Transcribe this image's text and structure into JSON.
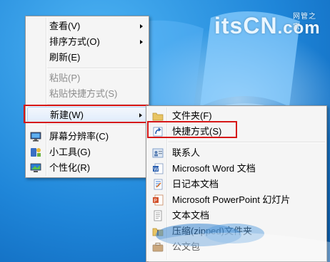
{
  "context_menu": {
    "items": [
      {
        "label": "查看(V)",
        "has_submenu": true,
        "enabled": true
      },
      {
        "label": "排序方式(O)",
        "has_submenu": true,
        "enabled": true
      },
      {
        "label": "刷新(E)",
        "has_submenu": false,
        "enabled": true
      },
      {
        "label": "粘贴(P)",
        "has_submenu": false,
        "enabled": false
      },
      {
        "label": "粘贴快捷方式(S)",
        "has_submenu": false,
        "enabled": false
      },
      {
        "label": "新建(W)",
        "has_submenu": true,
        "enabled": true,
        "highlighted": true
      },
      {
        "label": "屏幕分辨率(C)",
        "icon": "monitor-icon",
        "enabled": true
      },
      {
        "label": "小工具(G)",
        "icon": "gadgets-icon",
        "enabled": true
      },
      {
        "label": "个性化(R)",
        "icon": "personalize-icon",
        "enabled": true
      }
    ]
  },
  "new_submenu": {
    "items": [
      {
        "label": "文件夹(F)",
        "icon": "folder-icon"
      },
      {
        "label": "快捷方式(S)",
        "icon": "shortcut-icon",
        "highlighted": true
      },
      {
        "label": "联系人",
        "icon": "contact-icon"
      },
      {
        "label": "Microsoft Word 文档",
        "icon": "word-doc-icon"
      },
      {
        "label": "日记本文档",
        "icon": "journal-icon"
      },
      {
        "label": "Microsoft PowerPoint 幻灯片",
        "icon": "powerpoint-icon"
      },
      {
        "label": "文本文档",
        "icon": "text-doc-icon"
      },
      {
        "label": "压缩(zipped)文件夹",
        "icon": "zip-folder-icon"
      },
      {
        "label": "公文包",
        "icon": "briefcase-icon"
      }
    ]
  },
  "watermark": {
    "text": "itsCN",
    "suffix": ".com",
    "small": "网管之家"
  },
  "colors": {
    "highlight_border": "#d61616",
    "menu_bg": "#f5f5f5",
    "desktop": "#1f86d9"
  }
}
